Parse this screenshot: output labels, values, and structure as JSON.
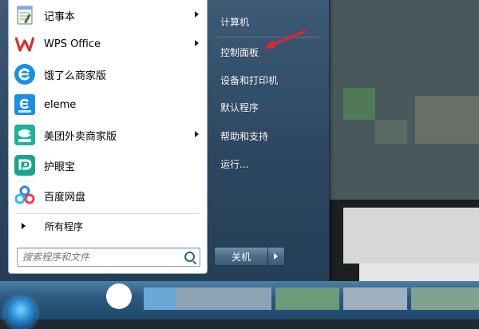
{
  "start_menu": {
    "programs": [
      {
        "label": "记事本",
        "icon": "notepad-icon",
        "has_submenu": true
      },
      {
        "label": "WPS Office",
        "icon": "wps-office-icon",
        "has_submenu": true
      },
      {
        "label": "饿了么商家版",
        "icon": "eleme-merchant-icon",
        "has_submenu": false
      },
      {
        "label": "eleme",
        "icon": "eleme-icon",
        "has_submenu": false
      },
      {
        "label": "美团外卖商家版",
        "icon": "meituan-merchant-icon",
        "has_submenu": true
      },
      {
        "label": "护眼宝",
        "icon": "eye-care-icon",
        "has_submenu": false
      },
      {
        "label": "百度网盘",
        "icon": "baidu-netdisk-icon",
        "has_submenu": false
      }
    ],
    "all_programs": "所有程序",
    "search": {
      "placeholder": "搜索程序和文件",
      "value": ""
    },
    "right_items": [
      {
        "label": "计算机"
      },
      {
        "label": "控制面板"
      },
      {
        "label": "设备和打印机"
      },
      {
        "label": "默认程序"
      },
      {
        "label": "帮助和支持"
      },
      {
        "label": "运行..."
      }
    ],
    "shutdown_label": "关机"
  },
  "colors": {
    "accent_red": "#e8232c",
    "menu_blue": "#2d4762",
    "wps_red": "#e02b2b",
    "eleme_blue": "#1a8fe3",
    "meituan_teal": "#1bb39a",
    "eye_teal": "#1aa58b"
  }
}
